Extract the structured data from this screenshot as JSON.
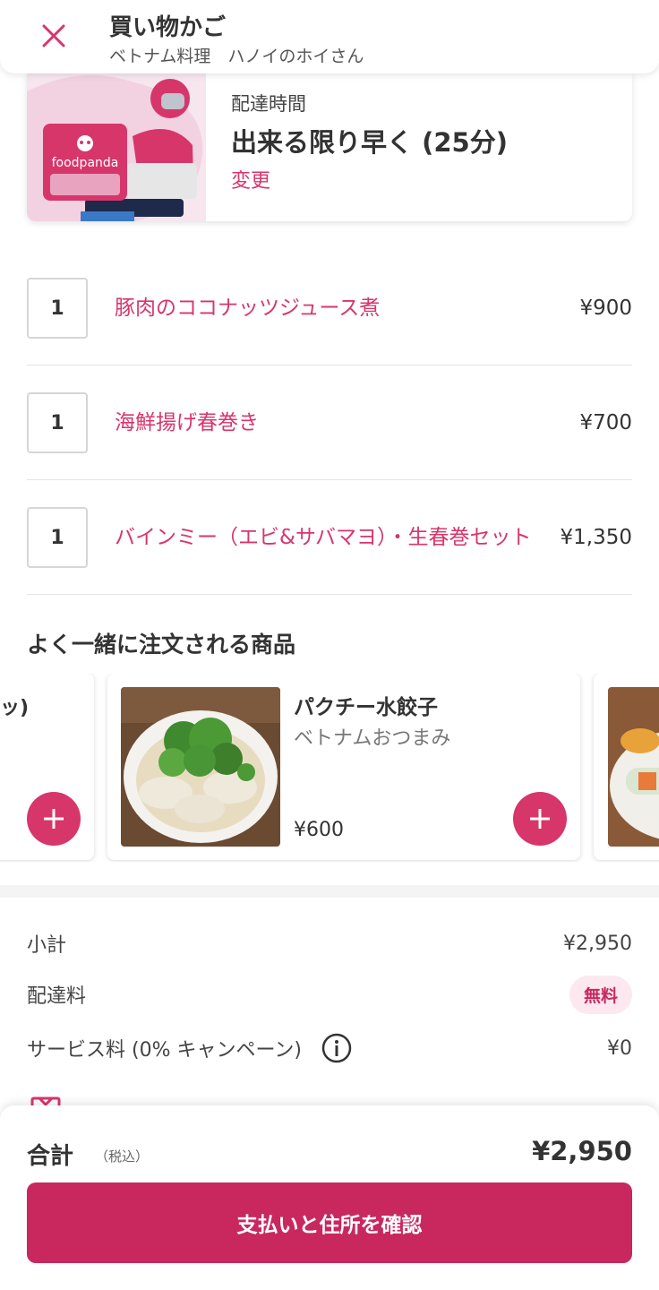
{
  "header": {
    "title": "買い物かご",
    "subtitle": "ベトナム料理　ハノイのホイさん",
    "close_icon": "close-icon"
  },
  "delivery": {
    "label": "配達時間",
    "time": "出来る限り早く (25分)",
    "change_label": "変更",
    "brand_text": "foodpanda",
    "illustration": "delivery-rider-icon"
  },
  "cart": {
    "items": [
      {
        "qty": "1",
        "name": "豚肉のココナッツジュース煮",
        "price": "¥900"
      },
      {
        "qty": "1",
        "name": "海鮮揚げ春巻き",
        "price": "¥700"
      },
      {
        "qty": "1",
        "name": "バインミー（エビ&サバマヨ）・生春巻セット",
        "price": "¥1,350"
      }
    ]
  },
  "recommendations": {
    "title": "よく一緒に注文される商品",
    "partial_left_text": "ッ)",
    "main": {
      "name": "パクチー水餃子",
      "category": "ベトナムおつまみ",
      "price": "¥600"
    }
  },
  "fees": {
    "subtotal_label": "小計",
    "subtotal_value": "¥2,950",
    "delivery_label": "配達料",
    "delivery_value": "無料",
    "service_label": "サービス料 (0% キャンペーン)",
    "service_value": "¥0"
  },
  "summary": {
    "total_label": "合計",
    "tax_note": "（税込）",
    "total_value": "¥2,950",
    "confirm_label": "支払いと住所を確認"
  },
  "colors": {
    "accent": "#d7366b",
    "button": "#c8285e"
  }
}
